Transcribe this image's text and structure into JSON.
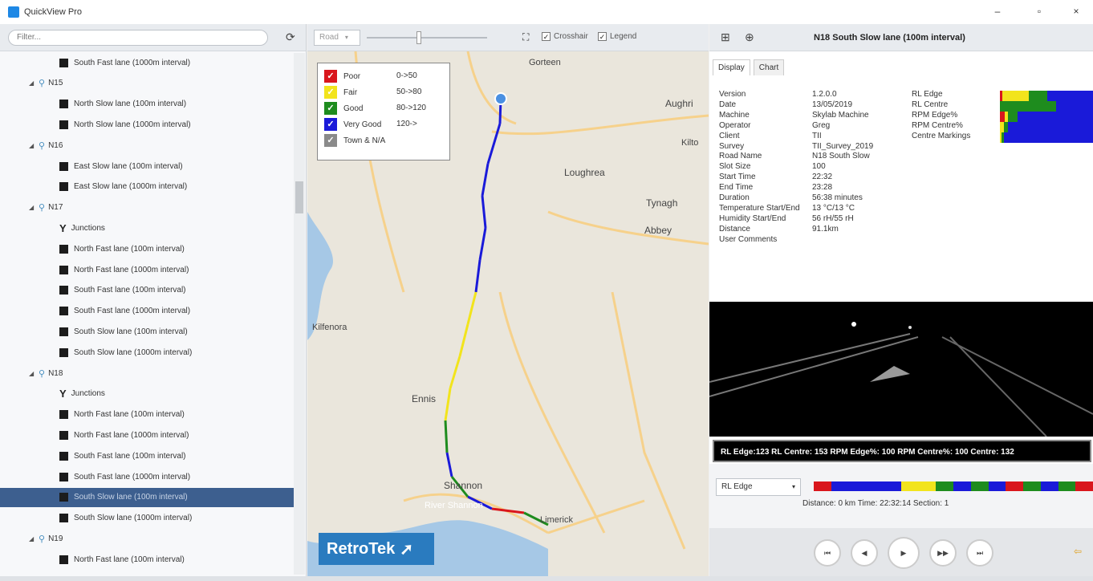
{
  "app": {
    "title": "QuickView Pro",
    "minimize": "–",
    "maximize": "▫",
    "close": "×"
  },
  "sidebar": {
    "filter_placeholder": "Filter...",
    "tree": [
      {
        "kind": "survey",
        "label": "South Fast lane (1000m interval)",
        "indent": 1
      },
      {
        "kind": "road",
        "label": "N15",
        "indent": 0
      },
      {
        "kind": "survey",
        "label": "North Slow lane (100m interval)",
        "indent": 1
      },
      {
        "kind": "survey",
        "label": "North Slow lane (1000m interval)",
        "indent": 1
      },
      {
        "kind": "road",
        "label": "N16",
        "indent": 0
      },
      {
        "kind": "survey",
        "label": "East Slow lane (100m interval)",
        "indent": 1
      },
      {
        "kind": "survey",
        "label": "East Slow lane (1000m interval)",
        "indent": 1
      },
      {
        "kind": "road",
        "label": "N17",
        "indent": 0
      },
      {
        "kind": "junction",
        "label": "Junctions",
        "indent": 1
      },
      {
        "kind": "survey",
        "label": "North Fast lane (100m interval)",
        "indent": 1
      },
      {
        "kind": "survey",
        "label": "North Fast lane (1000m interval)",
        "indent": 1
      },
      {
        "kind": "survey",
        "label": "South Fast lane (100m interval)",
        "indent": 1
      },
      {
        "kind": "survey",
        "label": "South Fast lane (1000m interval)",
        "indent": 1
      },
      {
        "kind": "survey",
        "label": "South Slow lane (100m interval)",
        "indent": 1
      },
      {
        "kind": "survey",
        "label": "South Slow lane (1000m interval)",
        "indent": 1
      },
      {
        "kind": "road",
        "label": "N18",
        "indent": 0
      },
      {
        "kind": "junction",
        "label": "Junctions",
        "indent": 1
      },
      {
        "kind": "survey",
        "label": "North Fast lane (100m interval)",
        "indent": 1
      },
      {
        "kind": "survey",
        "label": "North Fast lane (1000m interval)",
        "indent": 1
      },
      {
        "kind": "survey",
        "label": "South Fast lane (100m interval)",
        "indent": 1
      },
      {
        "kind": "survey",
        "label": "South Fast lane (1000m interval)",
        "indent": 1
      },
      {
        "kind": "survey",
        "label": "South Slow lane (100m interval)",
        "indent": 1,
        "selected": true
      },
      {
        "kind": "survey",
        "label": "South Slow lane (1000m interval)",
        "indent": 1
      },
      {
        "kind": "road",
        "label": "N19",
        "indent": 0
      },
      {
        "kind": "survey",
        "label": "North Fast lane (100m interval)",
        "indent": 1
      }
    ]
  },
  "map": {
    "layer_select": "Road",
    "crosshair_label": "Crosshair",
    "legend_label": "Legend",
    "legend": [
      {
        "name": "Poor",
        "range": "0->50",
        "color": "#d9161c"
      },
      {
        "name": "Fair",
        "range": "50->80",
        "color": "#f2e41c"
      },
      {
        "name": "Good",
        "range": "80->120",
        "color": "#1e8c1e"
      },
      {
        "name": "Very Good",
        "range": "120->",
        "color": "#1a1ad9"
      },
      {
        "name": "Town & N/A",
        "range": "",
        "color": "#8a8a8a"
      }
    ],
    "towns": {
      "gorteen": "Gorteen",
      "aughrim": "Aughri",
      "kilto": "Kilto",
      "loughrea": "Loughrea",
      "tynagh": "Tynagh",
      "abbey": "Abbey",
      "kilfenora": "Kilfenora",
      "ennis": "Ennis",
      "shannon": "Shannon",
      "river": "River Shannon",
      "limerick": "Limerick"
    },
    "logo": "RetroTek"
  },
  "panel": {
    "title": "N18 South Slow lane (100m interval)",
    "tabs": [
      "Display",
      "Chart"
    ],
    "info": [
      {
        "label": "Version",
        "value": "1.2.0.0"
      },
      {
        "label": "Date",
        "value": "13/05/2019"
      },
      {
        "label": "Machine",
        "value": "Skylab Machine"
      },
      {
        "label": "Operator",
        "value": "Greg"
      },
      {
        "label": "Client",
        "value": "TII"
      },
      {
        "label": "Survey",
        "value": "TII_Survey_2019"
      },
      {
        "label": "Road Name",
        "value": "N18 South Slow"
      },
      {
        "label": "Slot Size",
        "value": "100"
      },
      {
        "label": "Start Time",
        "value": "22:32"
      },
      {
        "label": "End Time",
        "value": "23:28"
      },
      {
        "label": "Duration",
        "value": "56:38 minutes"
      },
      {
        "label": "Temperature Start/End",
        "value": "13 °C/13 °C"
      },
      {
        "label": "Humidity Start/End",
        "value": "56 rH/55 rH"
      },
      {
        "label": "Distance",
        "value": "91.1km"
      },
      {
        "label": "User Comments",
        "value": ""
      }
    ],
    "bars": [
      {
        "label": "RL Edge",
        "segments": [
          [
            "#d9161c",
            0.03
          ],
          [
            "#f2e41c",
            0.28
          ],
          [
            "#1e8c1e",
            0.2
          ],
          [
            "#1a1ad9",
            0.49
          ]
        ]
      },
      {
        "label": "RL Centre",
        "segments": [
          [
            "#1e8c1e",
            0.6
          ],
          [
            "#1a1ad9",
            0.4
          ]
        ]
      },
      {
        "label": "RPM Edge%",
        "segments": [
          [
            "#d9161c",
            0.05
          ],
          [
            "#f2e41c",
            0.04
          ],
          [
            "#1e8c1e",
            0.1
          ],
          [
            "#1a1ad9",
            0.81
          ]
        ]
      },
      {
        "label": "RPM Centre%",
        "segments": [
          [
            "#f2e41c",
            0.04
          ],
          [
            "#1e8c1e",
            0.05
          ],
          [
            "#1a1ad9",
            0.91
          ]
        ]
      },
      {
        "label": "Centre Markings",
        "segments": [
          [
            "#f2e41c",
            0.02
          ],
          [
            "#1e8c1e",
            0.02
          ],
          [
            "#1a1ad9",
            0.96
          ]
        ]
      }
    ],
    "readout": "RL Edge:123  RL Centre: 153  RPM Edge%: 100  RPM Centre%: 100  Centre: 132",
    "rl_select": "RL Edge",
    "position": "Distance: 0 km   Time: 22:32:14   Section: 1",
    "buttons": [
      "⏮",
      "◀",
      "▶",
      "▶▶",
      "⏭"
    ]
  }
}
